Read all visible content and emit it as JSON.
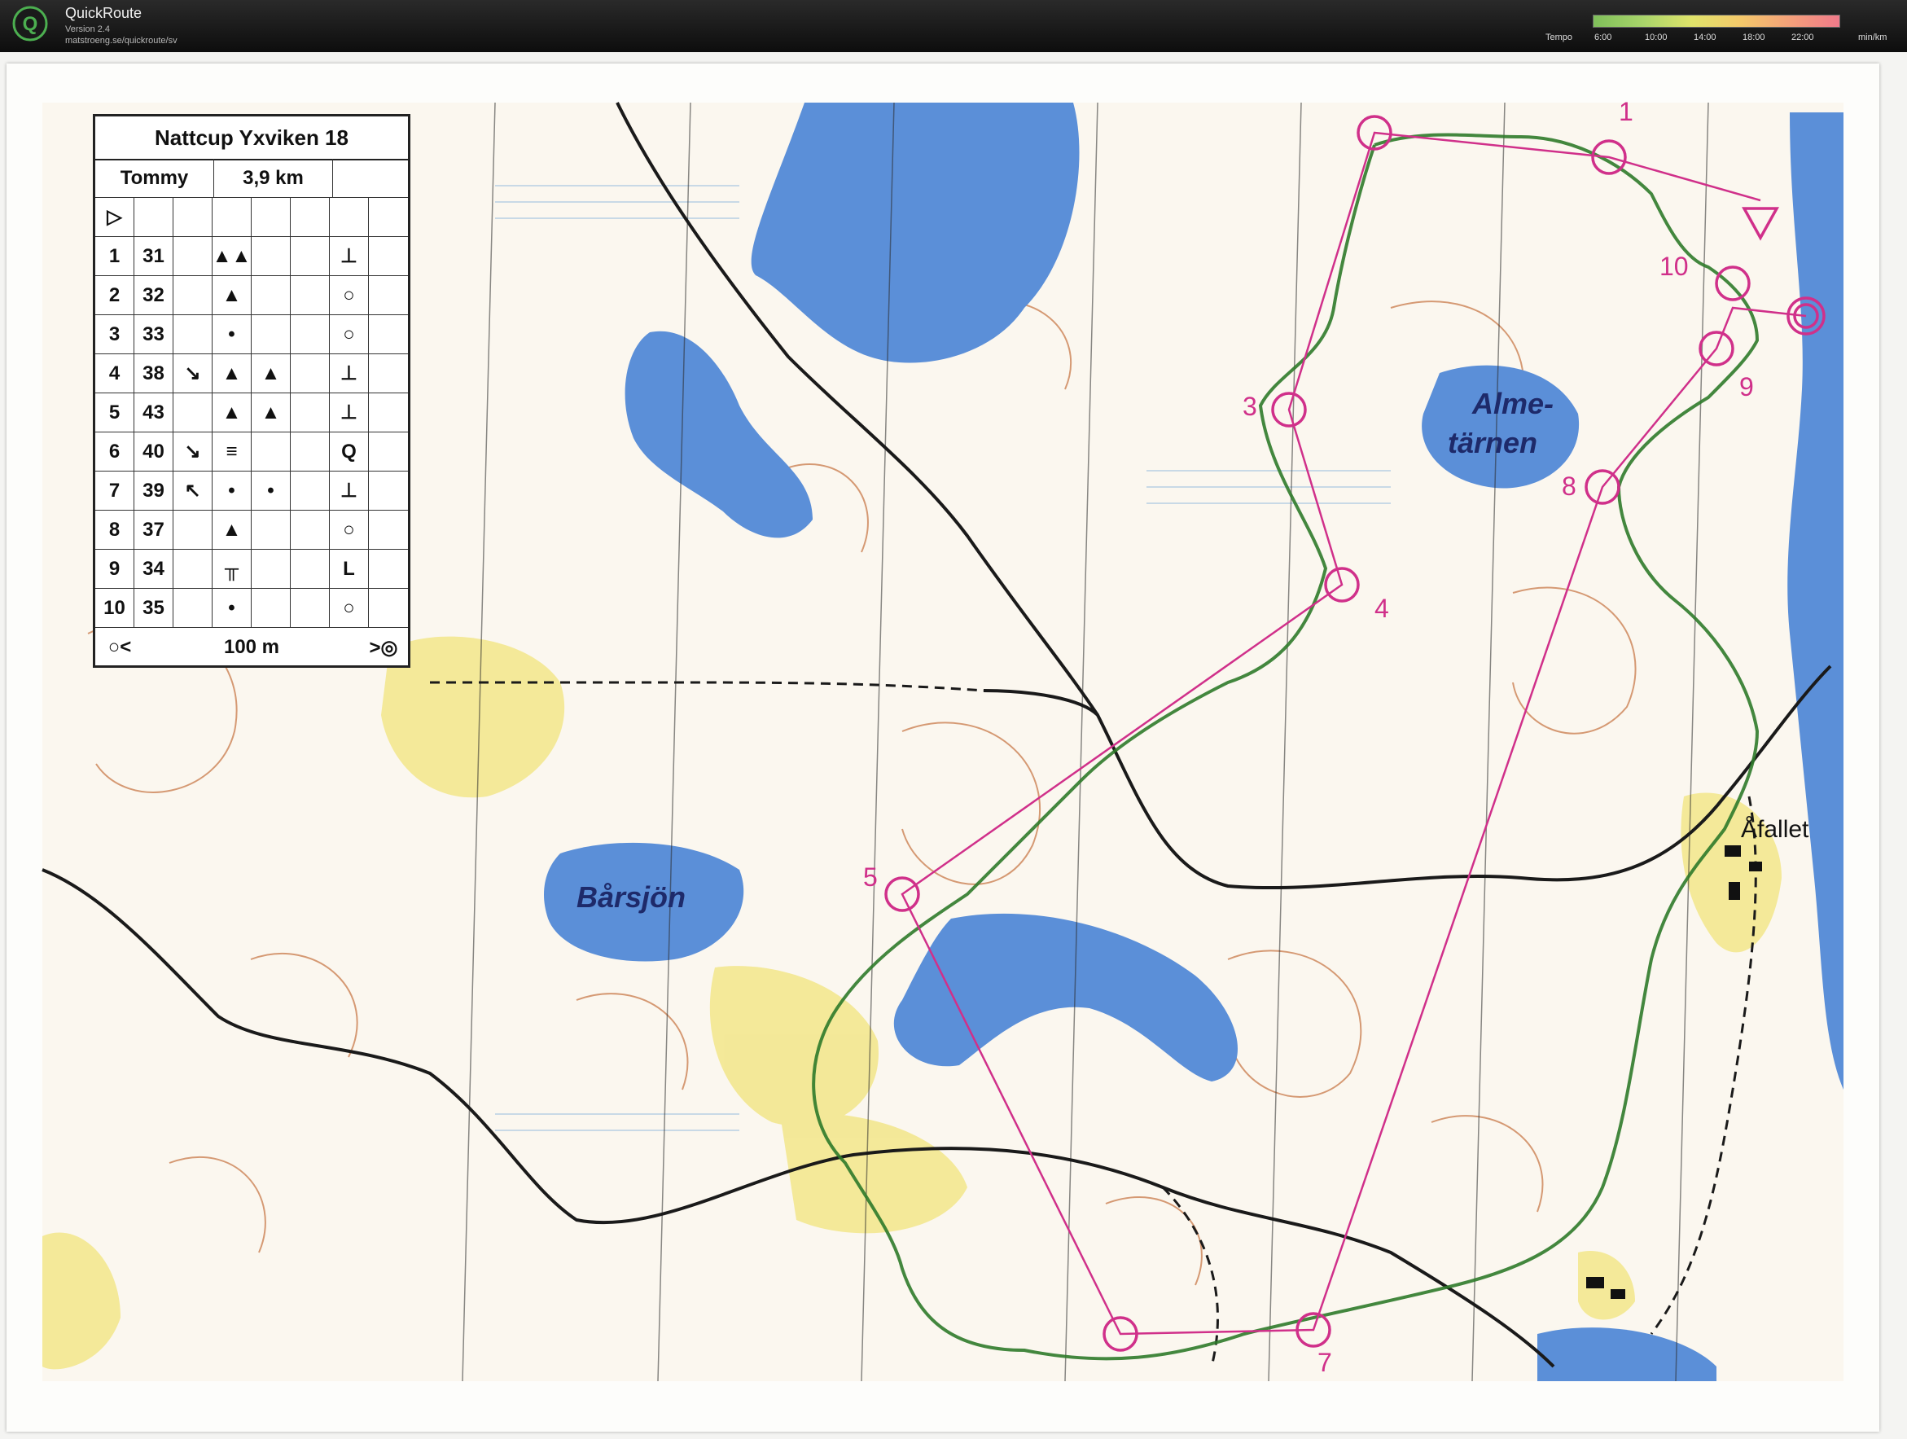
{
  "app": {
    "title": "QuickRoute",
    "version": "Version 2.4",
    "url": "matstroeng.se/quickroute/sv"
  },
  "tempo_legend": {
    "label": "Tempo",
    "ticks": [
      "6:00",
      "10:00",
      "14:00",
      "18:00",
      "22:00"
    ],
    "unit": "min/km",
    "colors": [
      "#7fbf5a",
      "#a8d46a",
      "#dfe36a",
      "#f4c86a",
      "#f4a07a",
      "#f07a8a"
    ]
  },
  "map": {
    "colors": {
      "water": "#5b8fd8",
      "open_land": "#f4e870",
      "contour": "#c87a4a",
      "route": "#3a7a30",
      "course": "#d0308a"
    },
    "place_names": {
      "lake_north_east": "Alme-\ntärnen",
      "lake_center": "Bårsjön",
      "village": "Åfallet"
    },
    "control_numbers": [
      "1",
      "3",
      "4",
      "5",
      "7",
      "8",
      "9",
      "10"
    ]
  },
  "description": {
    "title": "Nattcup Yxviken 18",
    "runner": "Tommy",
    "length": "3,9 km",
    "controls": [
      {
        "num": "1",
        "code": "31",
        "feature": "▲▲",
        "direction": "",
        "detail": "",
        "extra": "⊥"
      },
      {
        "num": "2",
        "code": "32",
        "feature": "▲",
        "direction": "",
        "detail": "",
        "extra": "○"
      },
      {
        "num": "3",
        "code": "33",
        "feature": "•",
        "direction": "",
        "detail": "",
        "extra": "○"
      },
      {
        "num": "4",
        "code": "38",
        "feature": "▲",
        "direction": "↘",
        "detail": "▲",
        "extra": "⊥"
      },
      {
        "num": "5",
        "code": "43",
        "feature": "▲",
        "direction": "",
        "detail": "▲",
        "extra": "⊥"
      },
      {
        "num": "6",
        "code": "40",
        "feature": "≡",
        "direction": "↘",
        "detail": "",
        "extra": "Q"
      },
      {
        "num": "7",
        "code": "39",
        "feature": "•",
        "direction": "↖",
        "detail": "•",
        "extra": "⊥"
      },
      {
        "num": "8",
        "code": "37",
        "feature": "▲",
        "direction": "",
        "detail": "",
        "extra": "○"
      },
      {
        "num": "9",
        "code": "34",
        "feature": "╥",
        "direction": "",
        "detail": "",
        "extra": "L"
      },
      {
        "num": "10",
        "code": "35",
        "feature": "•",
        "direction": "",
        "detail": "",
        "extra": "○"
      }
    ],
    "finish_distance": "100 m"
  }
}
